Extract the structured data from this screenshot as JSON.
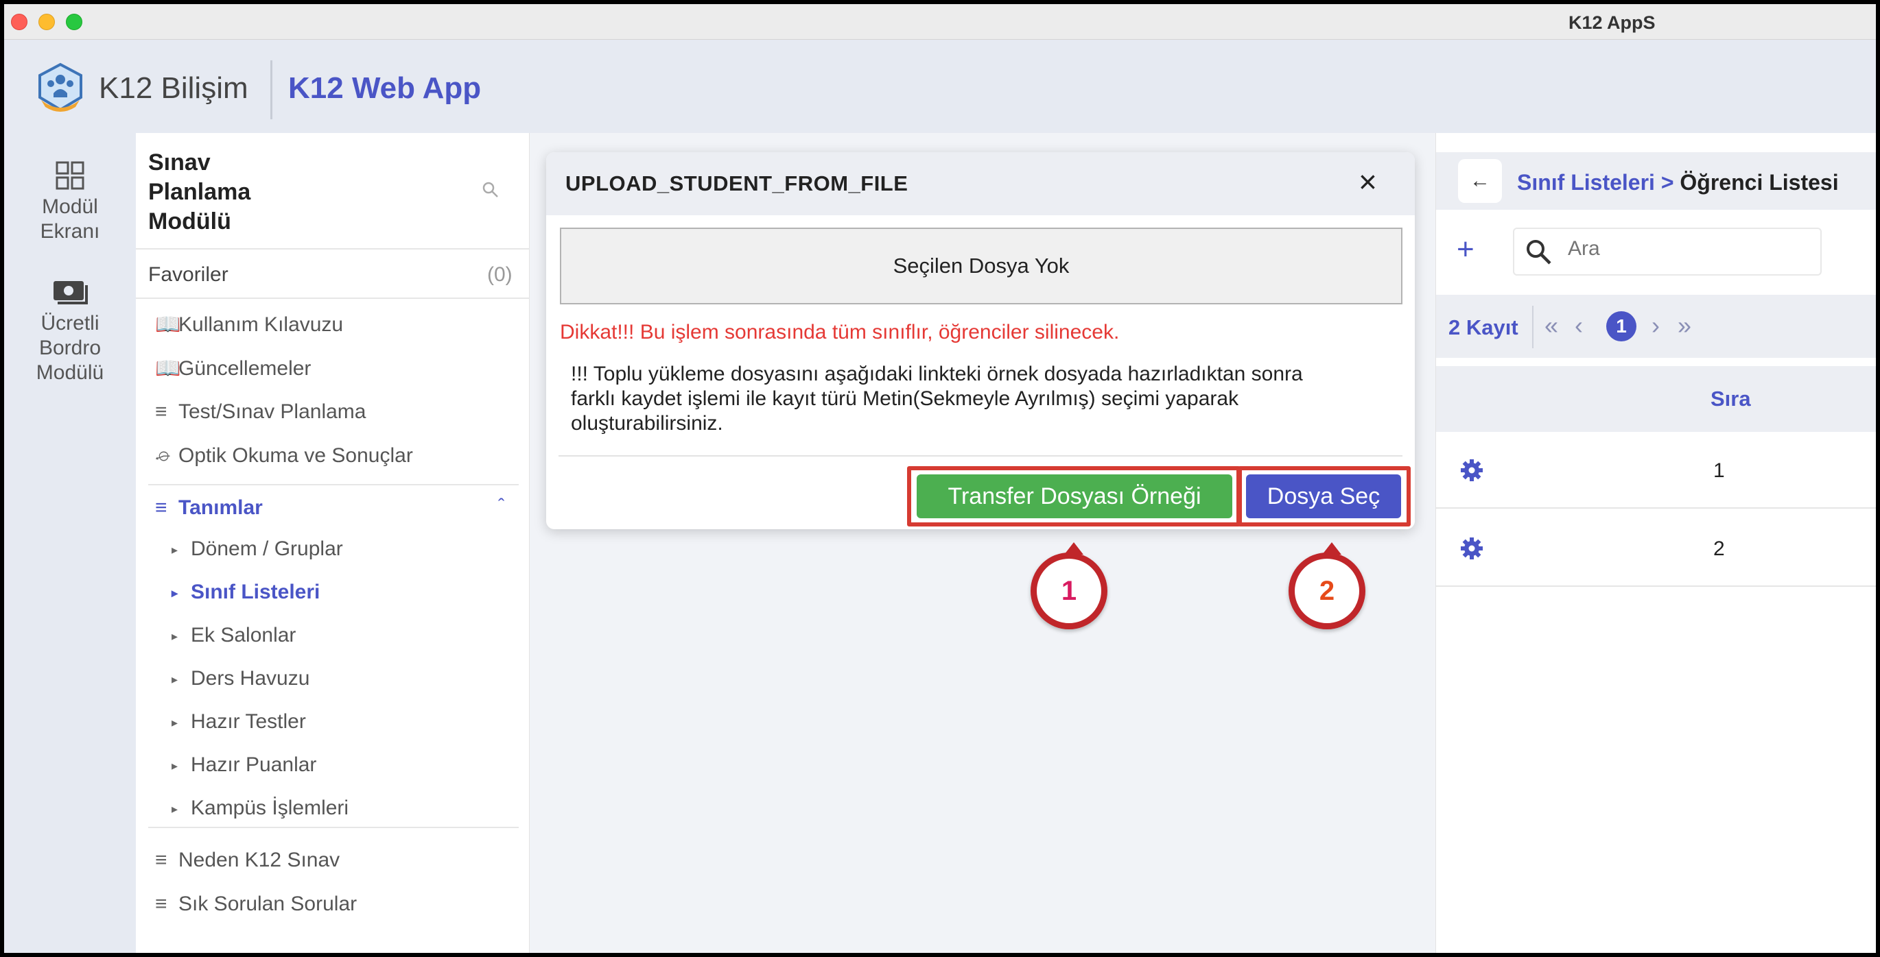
{
  "window": {
    "title": "K12 AppS"
  },
  "header": {
    "brand": "K12 Bilişim",
    "app_name": "K12 Web App"
  },
  "rail": {
    "items": [
      {
        "label_lines": [
          "Modül",
          "Ekranı"
        ],
        "icon": "grid-icon"
      },
      {
        "label_lines": [
          "Ücretli",
          "Bordro",
          "Modülü"
        ],
        "icon": "money-icon"
      }
    ]
  },
  "sidebar": {
    "title_lines": [
      "Sınav",
      "Planlama",
      "Modülü"
    ],
    "favorites_label": "Favoriler",
    "favorites_count": "(0)",
    "items": [
      {
        "label": "Kullanım Kılavuzu",
        "icon": "book-icon"
      },
      {
        "label": "Güncellemeler",
        "icon": "book-icon"
      },
      {
        "label": "Test/Sınav Planlama",
        "icon": "list-icon"
      },
      {
        "label": "Optik Okuma ve Sonuçlar",
        "icon": "scanner-icon"
      }
    ],
    "section": {
      "label": "Tanımlar",
      "icon": "playlist-add-icon"
    },
    "sub_items": [
      {
        "label": "Dönem / Gruplar"
      },
      {
        "label": "Sınıf Listeleri",
        "active": true
      },
      {
        "label": "Ek Salonlar"
      },
      {
        "label": "Ders Havuzu"
      },
      {
        "label": "Hazır Testler"
      },
      {
        "label": "Hazır Puanlar"
      },
      {
        "label": "Kampüs İşlemleri"
      }
    ],
    "bottom_items": [
      {
        "label": "Neden K12 Sınav",
        "icon": "list-icon"
      },
      {
        "label": "Sık Sorulan Sorular",
        "icon": "list-icon"
      }
    ]
  },
  "modal": {
    "title": "UPLOAD_STUDENT_FROM_FILE",
    "close_label": "×",
    "file_status": "Seçilen Dosya Yok",
    "warning": "Dikkat!!! Bu işlem sonrasında tüm sınıflır, öğrenciler silinecek.",
    "info_lines": [
      "!!! Toplu yükleme dosyasını aşağıdaki linkteki örnek dosyada hazırladıktan sonra",
      "farklı kaydet işlemi ile kayıt türü Metin(Sekmeyle Ayrılmış) seçimi yaparak",
      "oluşturabilirsiniz."
    ],
    "sample_button": "Transfer Dosyası Örneği",
    "select_button": "Dosya Seç"
  },
  "callouts": [
    "1",
    "2"
  ],
  "right_panel": {
    "back_label": "←",
    "breadcrumb_link": "Sınıf Listeleri >",
    "breadcrumb_current": "Öğrenci Listesi",
    "add_label": "+",
    "search_placeholder": "Ara",
    "record_count": "2 Kayıt",
    "pager": {
      "first": "«",
      "prev": "‹",
      "current": "1",
      "next": "›",
      "last": "»"
    },
    "column_header": "Sıra",
    "rows": [
      {
        "sira": "1"
      },
      {
        "sira": "2"
      }
    ]
  },
  "colors": {
    "accent": "#4a55c6",
    "success": "#4caf50",
    "danger": "#e53935",
    "highlight": "#d63b32"
  }
}
